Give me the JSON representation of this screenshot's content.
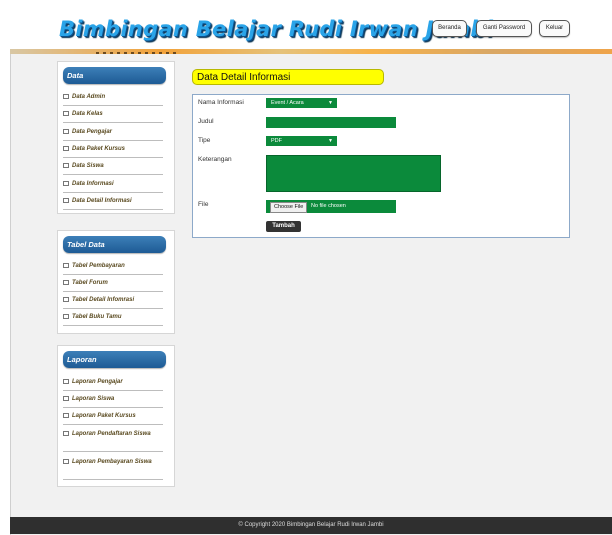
{
  "header": {
    "site_title": "Bimbingan Belajar Rudi Irwan Jambi",
    "nav": [
      {
        "label": "Beranda"
      },
      {
        "label": "Ganti Password"
      },
      {
        "label": "Keluar"
      }
    ]
  },
  "sidebar": {
    "data": {
      "title": "Data",
      "items": [
        {
          "label": "Data Admin"
        },
        {
          "label": "Data Kelas"
        },
        {
          "label": "Data Pengajar"
        },
        {
          "label": "Data Paket Kursus"
        },
        {
          "label": "Data Siswa"
        },
        {
          "label": "Data Informasi"
        },
        {
          "label": "Data Detail Informasi"
        }
      ]
    },
    "tabel": {
      "title": "Tabel Data",
      "items": [
        {
          "label": "Tabel Pembayaran"
        },
        {
          "label": "Tabel Forum"
        },
        {
          "label": "Tabel Detail Infomrasi"
        },
        {
          "label": "Tabel Buku Tamu"
        }
      ]
    },
    "laporan": {
      "title": "Laporan",
      "items": [
        {
          "label": "Laporan Pengajar"
        },
        {
          "label": "Laporan Siswa"
        },
        {
          "label": "Laporan Paket Kursus"
        },
        {
          "label": "Laporan Pendaftaran Siswa"
        },
        {
          "label": "Laporan Pembayaran Siswa"
        }
      ]
    }
  },
  "main": {
    "title": "Data Detail Informasi",
    "form": {
      "nama_informasi_label": "Nama Informasi",
      "nama_informasi_value": "Event / Acara",
      "judul_label": "Judul",
      "tipe_label": "Tipe",
      "tipe_value": "PDF",
      "keterangan_label": "Keterangan",
      "file_label": "File",
      "file_button": "Choose File",
      "file_status": "No file chosen",
      "submit_label": "Tambah"
    }
  },
  "footer": {
    "copyright": "© Copyright 2020 Bimbingan Belajar Rudi Irwan Jambi"
  },
  "colors": {
    "field_green": "#0b8a3b",
    "title_yellow": "#ffff00",
    "sidebar_title_blue": "#1d5b95"
  }
}
